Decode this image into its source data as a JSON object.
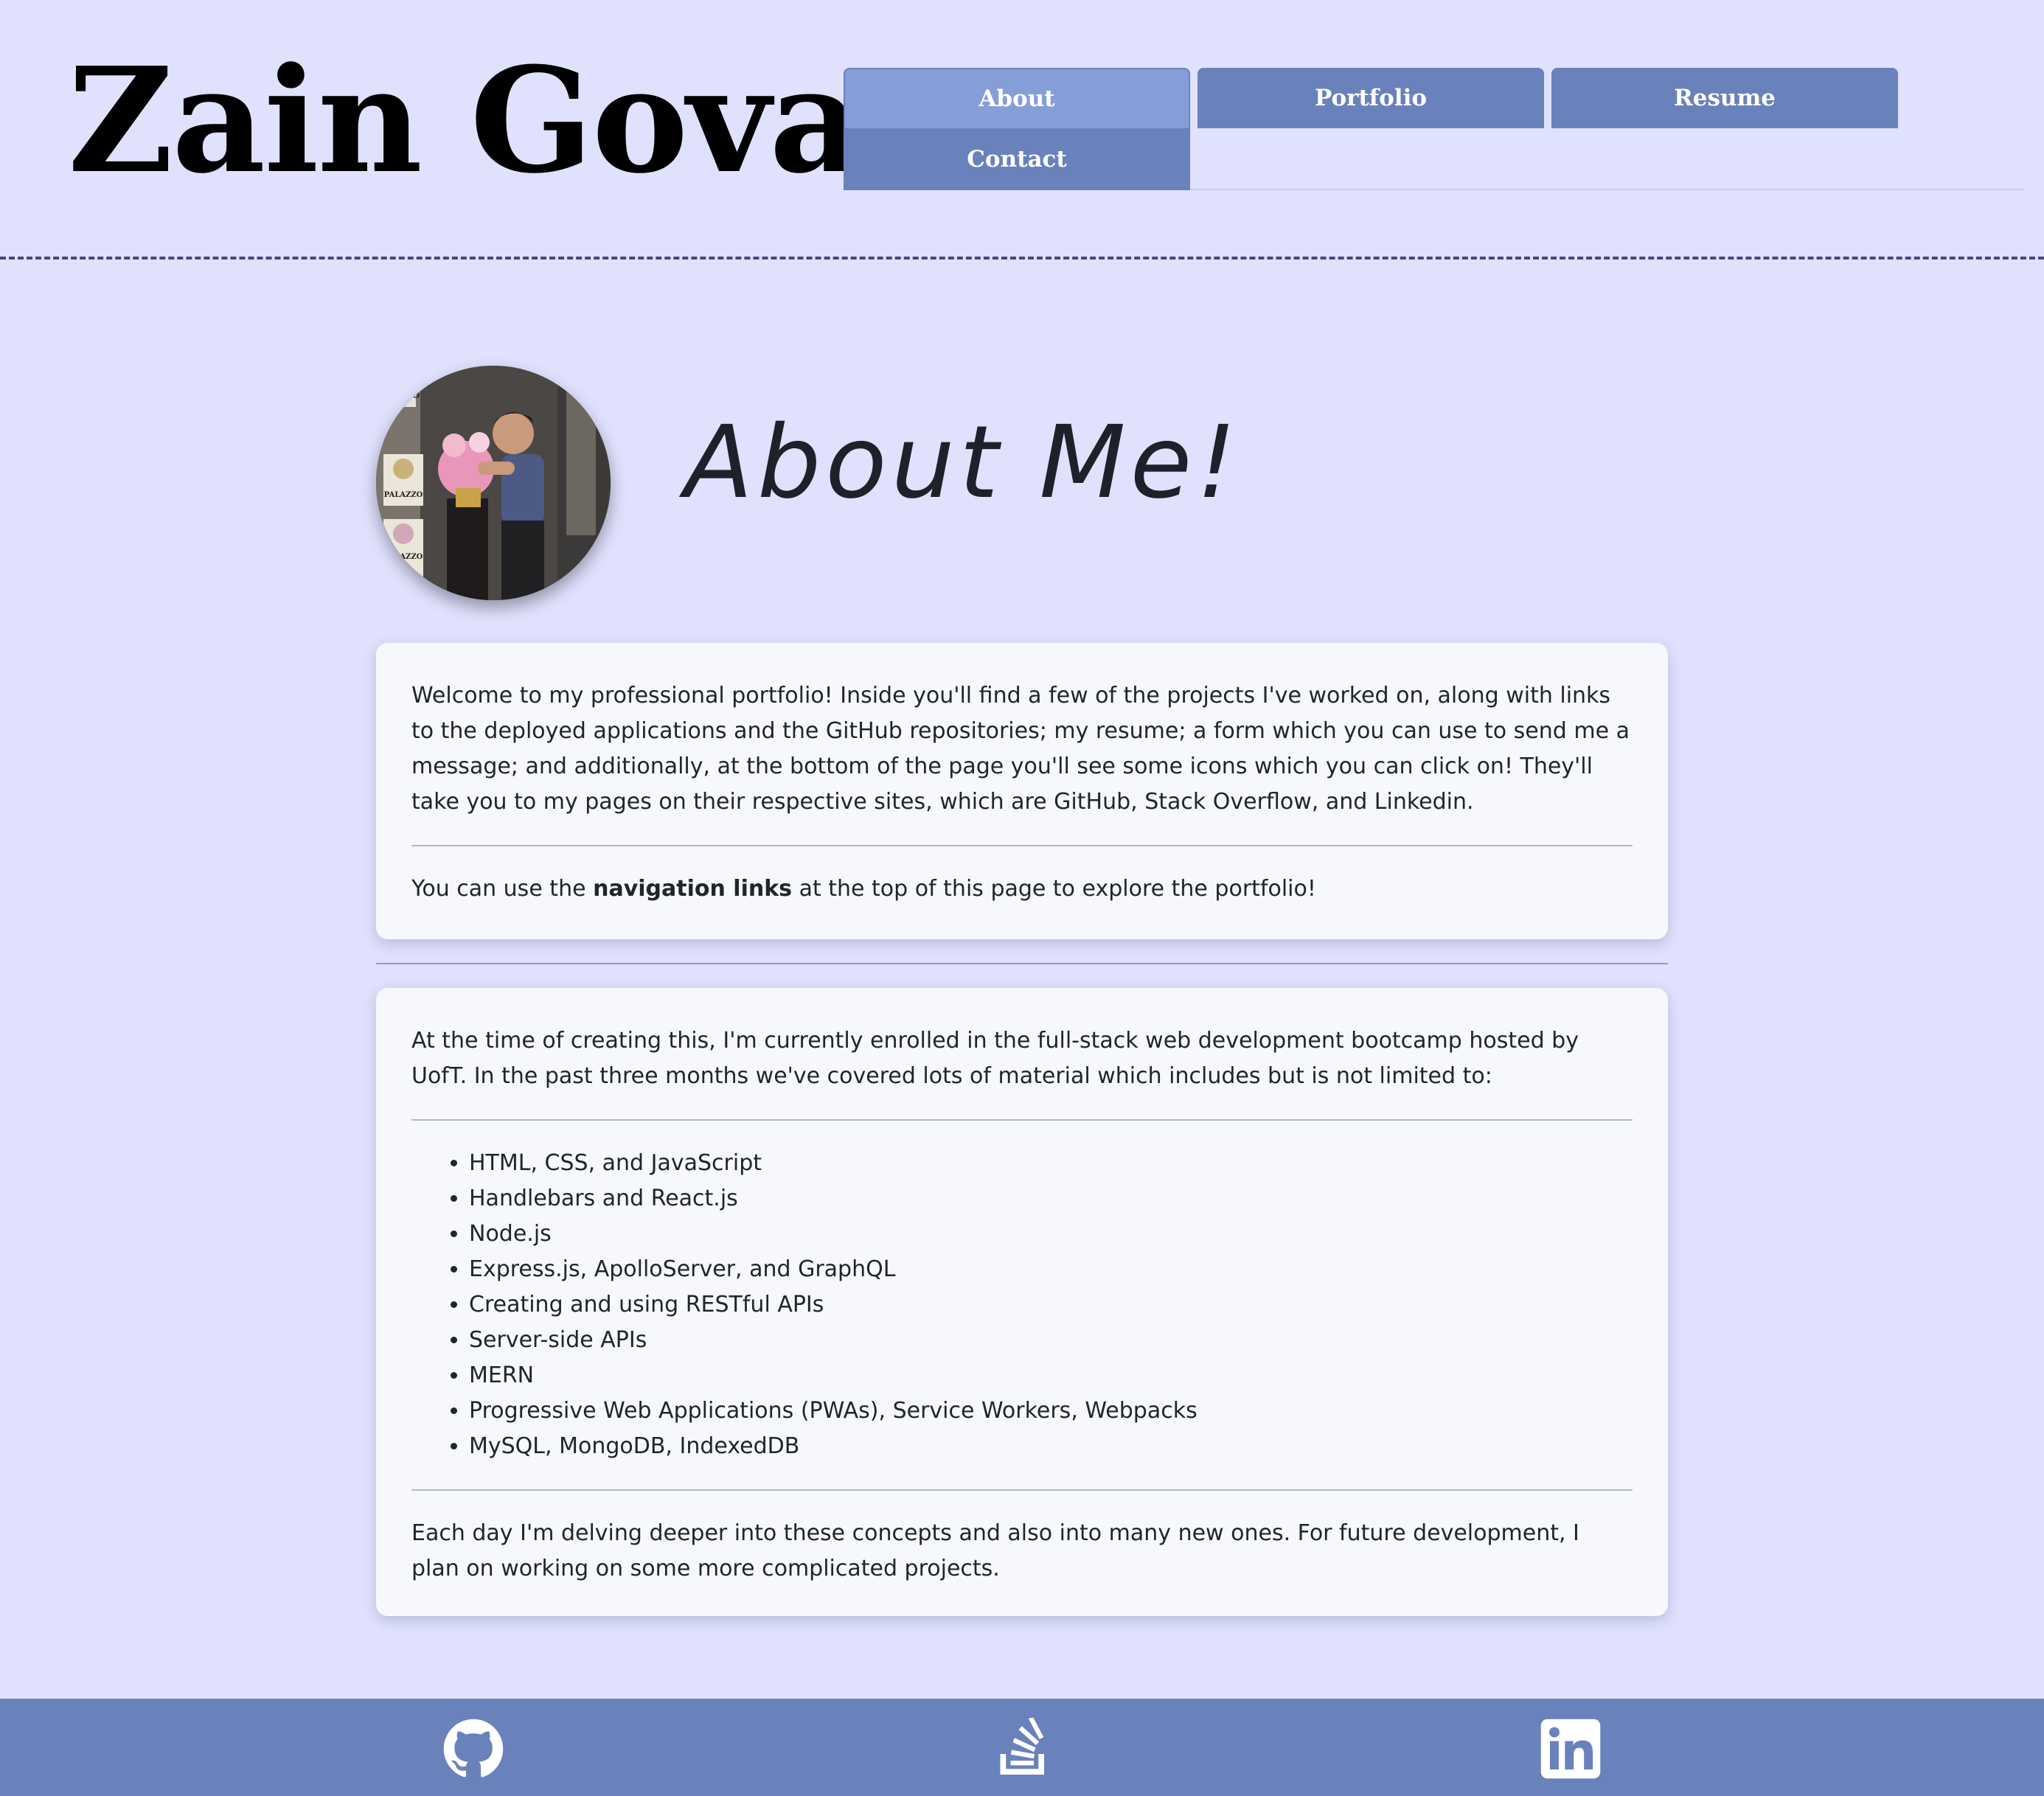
{
  "header": {
    "name": "Zain Gova",
    "nav": [
      {
        "label": "About",
        "active": true
      },
      {
        "label": "Portfolio",
        "active": false
      },
      {
        "label": "Resume",
        "active": false
      },
      {
        "label": "Contact",
        "active": false
      }
    ]
  },
  "about": {
    "heading": "About Me!",
    "avatar_signs": [
      "ALAZZO",
      "PALAZZO",
      "PALAZZO"
    ],
    "intro": {
      "paragraph": "Welcome to my professional portfolio! Inside you'll find a few of the projects I've worked on, along with links to the deployed applications and the GitHub repositories; my resume; a form which you can use to send me a message; and additionally, at the bottom of the page you'll see some icons which you can click on! They'll take you to my pages on their respective sites, which are GitHub, Stack Overflow, and Linkedin.",
      "nav_hint_before": "You can use the ",
      "nav_hint_bold": "navigation links",
      "nav_hint_after": " at the top of this page to explore the portfolio!"
    },
    "bootcamp": {
      "paragraph": "At the time of creating this, I'm currently enrolled in the full-stack web development bootcamp hosted by UofT. In the past three months we've covered lots of material which includes but is not limited to:",
      "skills": [
        "HTML, CSS, and JavaScript",
        "Handlebars and React.js",
        "Node.js",
        "Express.js, ApolloServer, and GraphQL",
        "Creating and using RESTful APIs",
        "Server-side APIs",
        "MERN",
        "Progressive Web Applications (PWAs), Service Workers, Webpacks",
        "MySQL, MongoDB, IndexedDB"
      ],
      "closing": "Each day I'm delving deeper into these concepts and also into many new ones. For future development, I plan on working on some more complicated projects."
    }
  },
  "footer": {
    "icons": [
      "github-icon",
      "stack-overflow-icon",
      "linkedin-icon"
    ]
  },
  "colors": {
    "page_background": "#dfe1fd",
    "nav_tab": "#6a82bb",
    "nav_tab_active": "#869ed8",
    "card_background": "#f7f8fc",
    "footer_background": "#6a82bb",
    "header_dashed_border": "#4a4580"
  }
}
